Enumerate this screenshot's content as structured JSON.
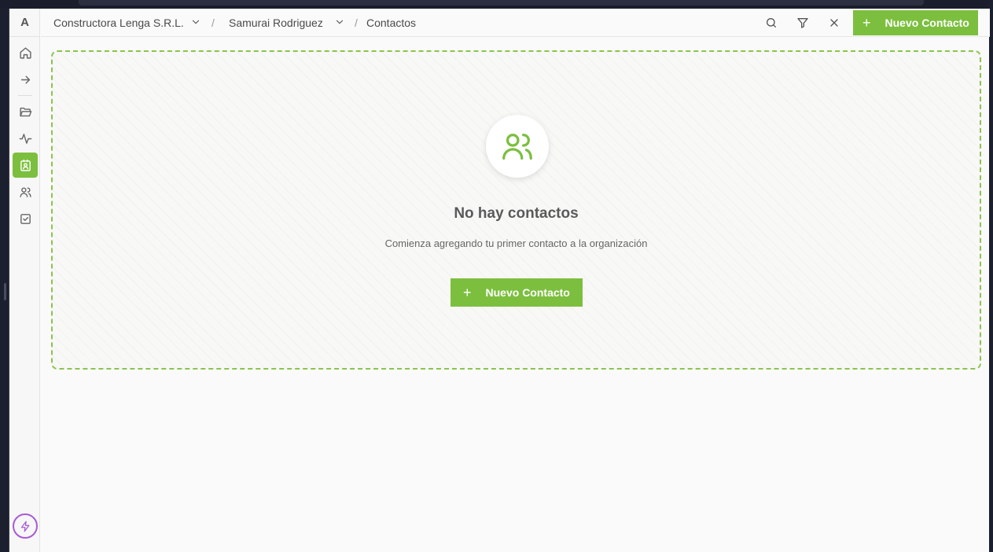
{
  "sidebar": {
    "logo": "A",
    "items": [
      {
        "name": "home",
        "icon": "home-icon"
      },
      {
        "name": "arrow-right",
        "icon": "arrow-right-icon"
      },
      {
        "name": "folder",
        "icon": "folder-open-icon"
      },
      {
        "name": "activity",
        "icon": "activity-icon"
      },
      {
        "name": "contacts",
        "icon": "contact-card-icon",
        "active": true
      },
      {
        "name": "users",
        "icon": "users-icon"
      },
      {
        "name": "tasks",
        "icon": "check-square-icon"
      }
    ],
    "bottom_icon": "bolt-icon"
  },
  "header": {
    "breadcrumb": {
      "organization": "Constructora Lenga S.R.L.",
      "user": "Samurai Rodriguez",
      "page": "Contactos",
      "separator": "/"
    },
    "actions": {
      "search_icon": "search-icon",
      "filter_icon": "filter-icon",
      "close_icon": "close-icon",
      "new_contact_label": "Nuevo Contacto",
      "plus": "+"
    }
  },
  "empty_state": {
    "icon": "users-icon",
    "title": "No hay contactos",
    "subtitle": "Comienza agregando tu primer contacto a la organización",
    "button_label": "Nuevo Contacto",
    "plus": "+"
  },
  "colors": {
    "accent": "#7cbf3e",
    "dashed_border": "#8ac44f",
    "bolt": "#a85ad6"
  }
}
